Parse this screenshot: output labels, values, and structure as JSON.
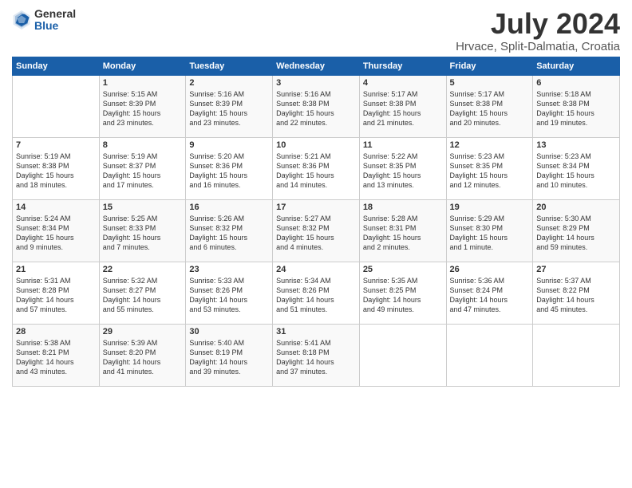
{
  "logo": {
    "general": "General",
    "blue": "Blue"
  },
  "title": "July 2024",
  "location": "Hrvace, Split-Dalmatia, Croatia",
  "calendar": {
    "headers": [
      "Sunday",
      "Monday",
      "Tuesday",
      "Wednesday",
      "Thursday",
      "Friday",
      "Saturday"
    ],
    "weeks": [
      [
        {
          "day": "",
          "info": ""
        },
        {
          "day": "1",
          "info": "Sunrise: 5:15 AM\nSunset: 8:39 PM\nDaylight: 15 hours\nand 23 minutes."
        },
        {
          "day": "2",
          "info": "Sunrise: 5:16 AM\nSunset: 8:39 PM\nDaylight: 15 hours\nand 23 minutes."
        },
        {
          "day": "3",
          "info": "Sunrise: 5:16 AM\nSunset: 8:38 PM\nDaylight: 15 hours\nand 22 minutes."
        },
        {
          "day": "4",
          "info": "Sunrise: 5:17 AM\nSunset: 8:38 PM\nDaylight: 15 hours\nand 21 minutes."
        },
        {
          "day": "5",
          "info": "Sunrise: 5:17 AM\nSunset: 8:38 PM\nDaylight: 15 hours\nand 20 minutes."
        },
        {
          "day": "6",
          "info": "Sunrise: 5:18 AM\nSunset: 8:38 PM\nDaylight: 15 hours\nand 19 minutes."
        }
      ],
      [
        {
          "day": "7",
          "info": "Sunrise: 5:19 AM\nSunset: 8:38 PM\nDaylight: 15 hours\nand 18 minutes."
        },
        {
          "day": "8",
          "info": "Sunrise: 5:19 AM\nSunset: 8:37 PM\nDaylight: 15 hours\nand 17 minutes."
        },
        {
          "day": "9",
          "info": "Sunrise: 5:20 AM\nSunset: 8:36 PM\nDaylight: 15 hours\nand 16 minutes."
        },
        {
          "day": "10",
          "info": "Sunrise: 5:21 AM\nSunset: 8:36 PM\nDaylight: 15 hours\nand 14 minutes."
        },
        {
          "day": "11",
          "info": "Sunrise: 5:22 AM\nSunset: 8:35 PM\nDaylight: 15 hours\nand 13 minutes."
        },
        {
          "day": "12",
          "info": "Sunrise: 5:23 AM\nSunset: 8:35 PM\nDaylight: 15 hours\nand 12 minutes."
        },
        {
          "day": "13",
          "info": "Sunrise: 5:23 AM\nSunset: 8:34 PM\nDaylight: 15 hours\nand 10 minutes."
        }
      ],
      [
        {
          "day": "14",
          "info": "Sunrise: 5:24 AM\nSunset: 8:34 PM\nDaylight: 15 hours\nand 9 minutes."
        },
        {
          "day": "15",
          "info": "Sunrise: 5:25 AM\nSunset: 8:33 PM\nDaylight: 15 hours\nand 7 minutes."
        },
        {
          "day": "16",
          "info": "Sunrise: 5:26 AM\nSunset: 8:32 PM\nDaylight: 15 hours\nand 6 minutes."
        },
        {
          "day": "17",
          "info": "Sunrise: 5:27 AM\nSunset: 8:32 PM\nDaylight: 15 hours\nand 4 minutes."
        },
        {
          "day": "18",
          "info": "Sunrise: 5:28 AM\nSunset: 8:31 PM\nDaylight: 15 hours\nand 2 minutes."
        },
        {
          "day": "19",
          "info": "Sunrise: 5:29 AM\nSunset: 8:30 PM\nDaylight: 15 hours\nand 1 minute."
        },
        {
          "day": "20",
          "info": "Sunrise: 5:30 AM\nSunset: 8:29 PM\nDaylight: 14 hours\nand 59 minutes."
        }
      ],
      [
        {
          "day": "21",
          "info": "Sunrise: 5:31 AM\nSunset: 8:28 PM\nDaylight: 14 hours\nand 57 minutes."
        },
        {
          "day": "22",
          "info": "Sunrise: 5:32 AM\nSunset: 8:27 PM\nDaylight: 14 hours\nand 55 minutes."
        },
        {
          "day": "23",
          "info": "Sunrise: 5:33 AM\nSunset: 8:26 PM\nDaylight: 14 hours\nand 53 minutes."
        },
        {
          "day": "24",
          "info": "Sunrise: 5:34 AM\nSunset: 8:26 PM\nDaylight: 14 hours\nand 51 minutes."
        },
        {
          "day": "25",
          "info": "Sunrise: 5:35 AM\nSunset: 8:25 PM\nDaylight: 14 hours\nand 49 minutes."
        },
        {
          "day": "26",
          "info": "Sunrise: 5:36 AM\nSunset: 8:24 PM\nDaylight: 14 hours\nand 47 minutes."
        },
        {
          "day": "27",
          "info": "Sunrise: 5:37 AM\nSunset: 8:22 PM\nDaylight: 14 hours\nand 45 minutes."
        }
      ],
      [
        {
          "day": "28",
          "info": "Sunrise: 5:38 AM\nSunset: 8:21 PM\nDaylight: 14 hours\nand 43 minutes."
        },
        {
          "day": "29",
          "info": "Sunrise: 5:39 AM\nSunset: 8:20 PM\nDaylight: 14 hours\nand 41 minutes."
        },
        {
          "day": "30",
          "info": "Sunrise: 5:40 AM\nSunset: 8:19 PM\nDaylight: 14 hours\nand 39 minutes."
        },
        {
          "day": "31",
          "info": "Sunrise: 5:41 AM\nSunset: 8:18 PM\nDaylight: 14 hours\nand 37 minutes."
        },
        {
          "day": "",
          "info": ""
        },
        {
          "day": "",
          "info": ""
        },
        {
          "day": "",
          "info": ""
        }
      ]
    ]
  }
}
